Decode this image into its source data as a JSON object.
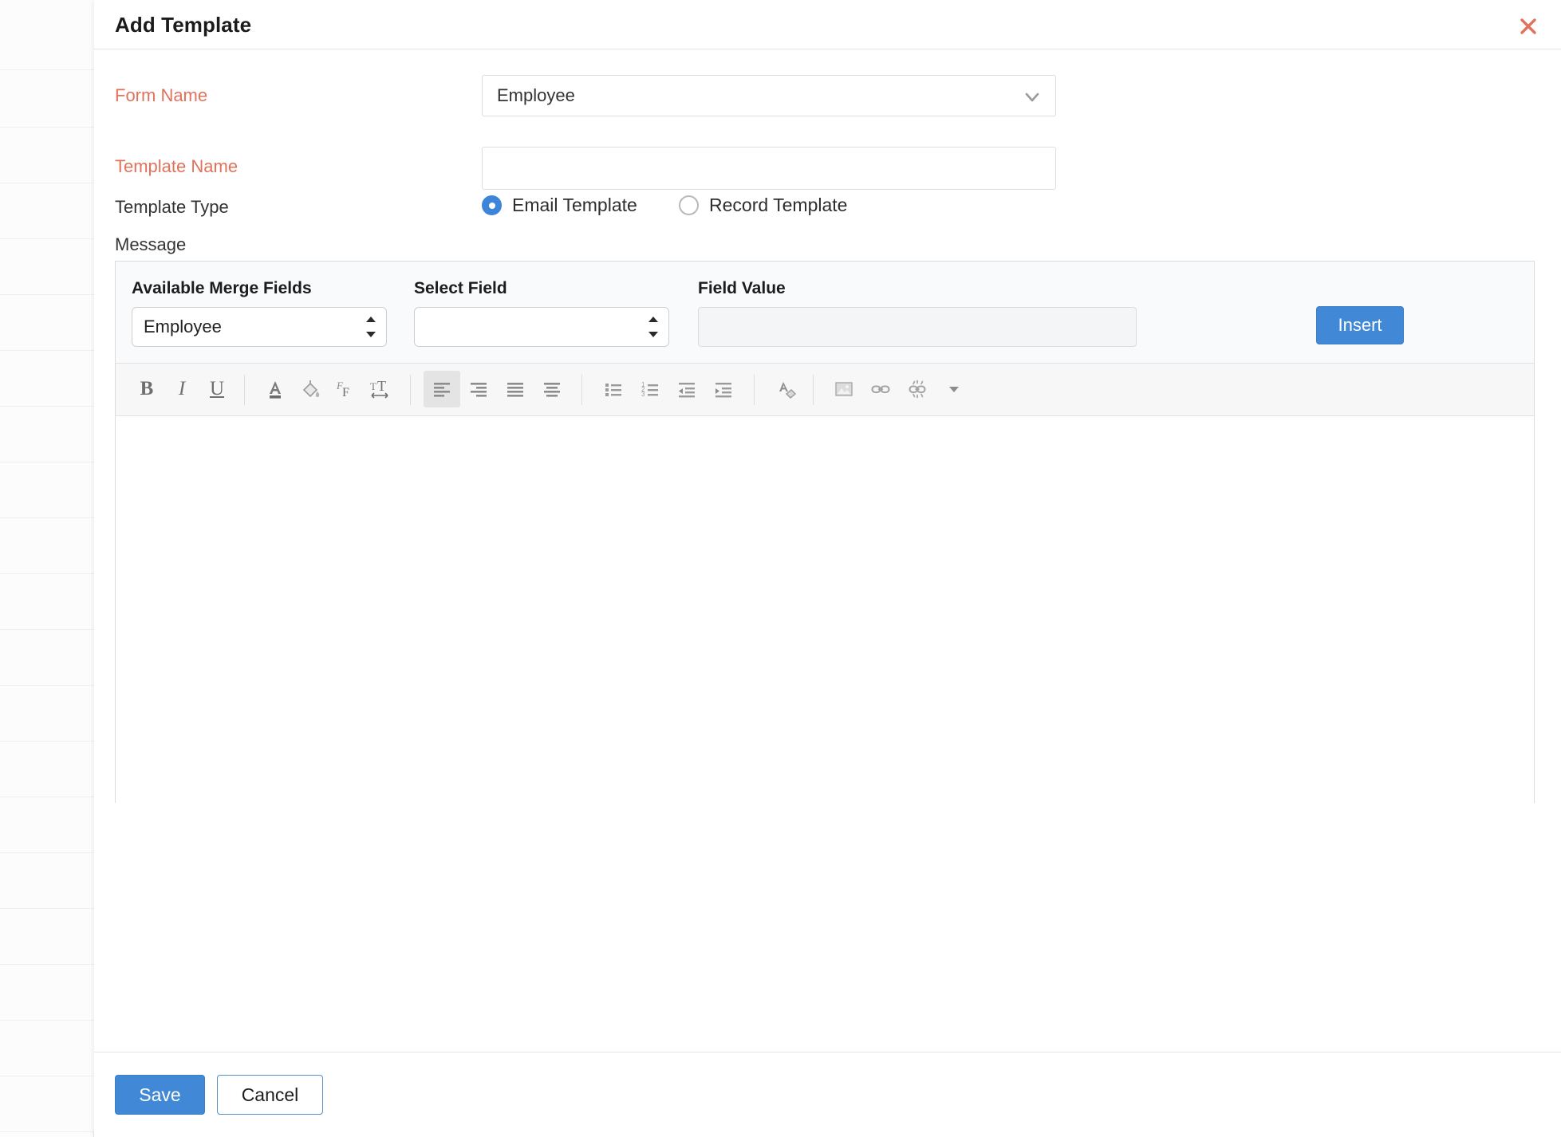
{
  "modal": {
    "title": "Add Template",
    "close_icon": "close-x-icon"
  },
  "form": {
    "form_name": {
      "label": "Form Name",
      "required": true,
      "value": "Employee",
      "chevron_icon": "chevron-down-icon"
    },
    "template_name": {
      "label": "Template Name",
      "required": true,
      "value": "",
      "placeholder": ""
    },
    "template_type": {
      "label": "Template Type",
      "options": [
        {
          "label": "Email Template",
          "selected": true
        },
        {
          "label": "Record Template",
          "selected": false
        }
      ]
    },
    "message": {
      "label": "Message"
    }
  },
  "merge_panel": {
    "available_merge_fields": {
      "label": "Available Merge Fields",
      "value": "Employee"
    },
    "select_field": {
      "label": "Select Field",
      "value": ""
    },
    "field_value": {
      "label": "Field Value",
      "value": "",
      "placeholder": ""
    },
    "insert_label": "Insert"
  },
  "toolbar": {
    "items": [
      {
        "name": "bold-icon",
        "glyph": "B"
      },
      {
        "name": "italic-icon",
        "glyph": "I"
      },
      {
        "name": "underline-icon",
        "glyph": "U"
      },
      {
        "name": "font-color-icon",
        "glyph": "A"
      },
      {
        "name": "background-color-icon",
        "glyph": "paint-bucket"
      },
      {
        "name": "font-family-icon",
        "glyph": "F"
      },
      {
        "name": "font-size-icon",
        "glyph": "T"
      },
      {
        "name": "align-left-icon",
        "glyph": "align-left"
      },
      {
        "name": "align-right-icon",
        "glyph": "align-right"
      },
      {
        "name": "align-justify-icon",
        "glyph": "align-justify"
      },
      {
        "name": "align-center-icon",
        "glyph": "align-center"
      },
      {
        "name": "bullet-list-icon",
        "glyph": "ul"
      },
      {
        "name": "numbered-list-icon",
        "glyph": "ol"
      },
      {
        "name": "outdent-icon",
        "glyph": "outdent"
      },
      {
        "name": "indent-icon",
        "glyph": "indent"
      },
      {
        "name": "clear-formatting-icon",
        "glyph": "eraser"
      },
      {
        "name": "insert-image-icon",
        "glyph": "image"
      },
      {
        "name": "insert-link-icon",
        "glyph": "link"
      },
      {
        "name": "unlink-icon",
        "glyph": "unlink"
      },
      {
        "name": "more-options-icon",
        "glyph": "caret-down"
      }
    ]
  },
  "footer": {
    "save_label": "Save",
    "cancel_label": "Cancel"
  },
  "colors": {
    "required_label": "#e2725b",
    "primary_button": "#4189d6",
    "radio_selected": "#3d85d8",
    "close_icon": "#e2725b"
  }
}
